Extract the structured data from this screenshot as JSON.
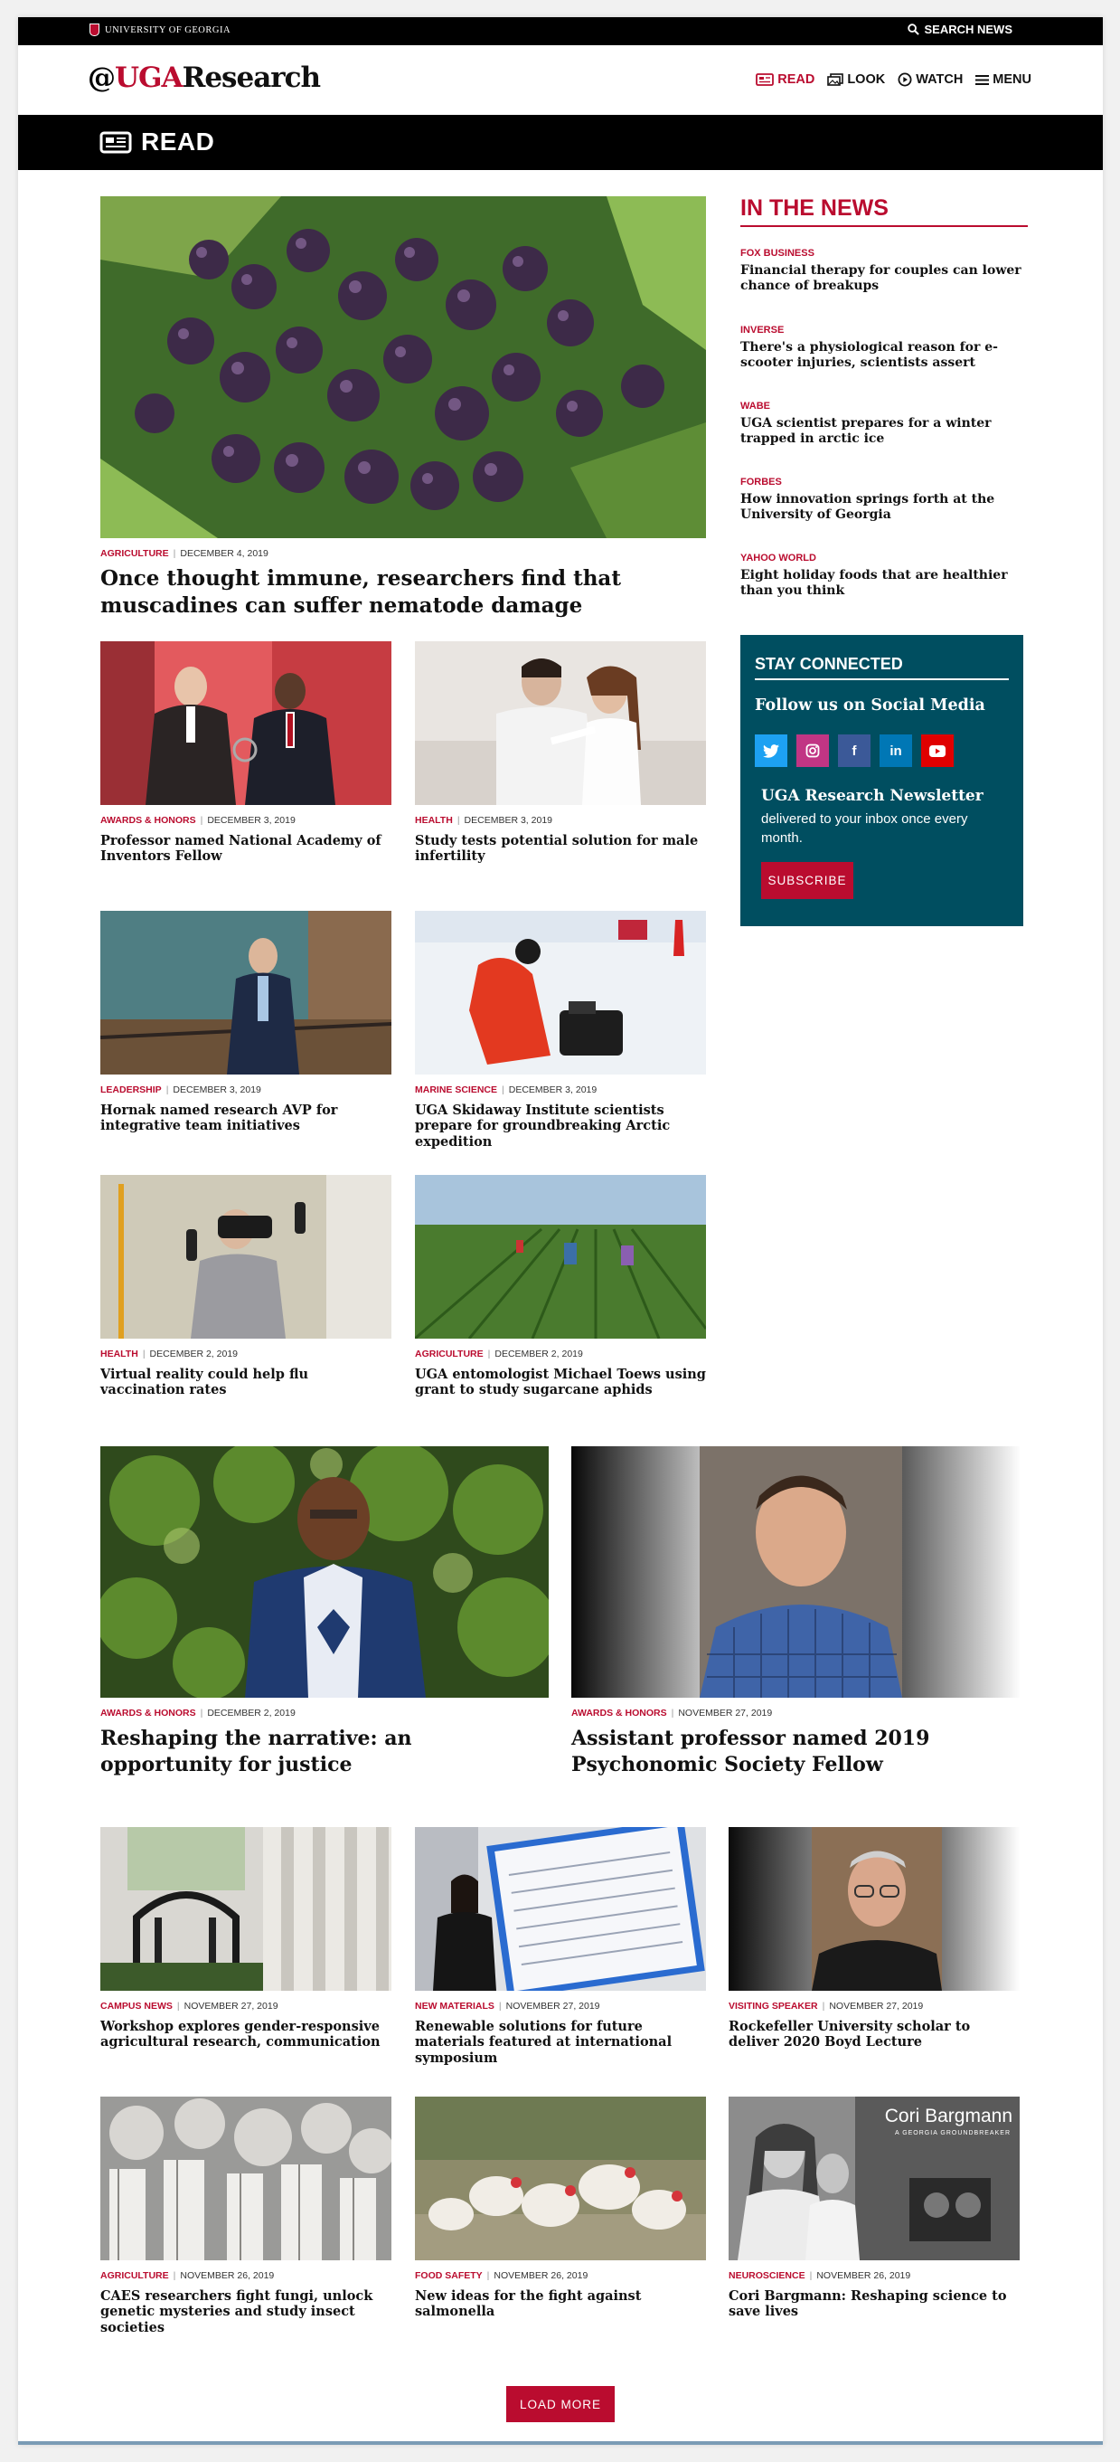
{
  "topbar": {
    "university": "UNIVERSITY OF GEORGIA",
    "search_label": "SEARCH NEWS"
  },
  "header": {
    "logo_at": "@",
    "logo_uga": "UGA",
    "logo_research": "Research",
    "nav": [
      {
        "label": "READ",
        "icon": "newspaper-icon",
        "active": true
      },
      {
        "label": "LOOK",
        "icon": "images-icon",
        "active": false
      },
      {
        "label": "WATCH",
        "icon": "play-circle-icon",
        "active": false
      },
      {
        "label": "MENU",
        "icon": "hamburger-icon",
        "active": false
      }
    ]
  },
  "section": {
    "label": "READ"
  },
  "featured": {
    "category": "AGRICULTURE",
    "date": "DECEMBER 4, 2019",
    "title": "Once thought immune, researchers find that muscadines can suffer nematode damage"
  },
  "grid_top": [
    {
      "category": "AWARDS & HONORS",
      "date": "DECEMBER 3, 2019",
      "title": "Professor named National Academy of Inventors Fellow"
    },
    {
      "category": "HEALTH",
      "date": "DECEMBER 3, 2019",
      "title": "Study tests potential solution for male infertility"
    },
    {
      "category": "LEADERSHIP",
      "date": "DECEMBER 3, 2019",
      "title": "Hornak named research AVP for integrative team initiatives"
    },
    {
      "category": "MARINE SCIENCE",
      "date": "DECEMBER 3, 2019",
      "title": "UGA Skidaway Institute scientists prepare for groundbreaking Arctic expedition"
    },
    {
      "category": "HEALTH",
      "date": "DECEMBER 2, 2019",
      "title": "Virtual reality could help flu vaccination rates"
    },
    {
      "category": "AGRICULTURE",
      "date": "DECEMBER 2, 2019",
      "title": "UGA entomologist Michael Toews using grant to study sugarcane aphids"
    }
  ],
  "in_the_news": {
    "heading": "IN THE NEWS",
    "items": [
      {
        "source": "FOX BUSINESS",
        "title": "Financial therapy for couples can lower chance of breakups"
      },
      {
        "source": "INVERSE",
        "title": "There's a physiological reason for e-scooter injuries, scientists assert"
      },
      {
        "source": "WABE",
        "title": "UGA scientist prepares for a winter trapped in arctic ice"
      },
      {
        "source": "FORBES",
        "title": "How innovation springs forth at the University of Georgia"
      },
      {
        "source": "YAHOO WORLD",
        "title": "Eight holiday foods that are healthier than you think"
      }
    ]
  },
  "stay_connected": {
    "heading": "STAY CONNECTED",
    "follow": "Follow us on Social Media",
    "socials": [
      {
        "icon": "twitter-icon",
        "glyph": "🐦",
        "color": "#1da1f2"
      },
      {
        "icon": "instagram-icon",
        "glyph": "◎",
        "color": "#c13584"
      },
      {
        "icon": "facebook-icon",
        "glyph": "f",
        "color": "#3b5998"
      },
      {
        "icon": "linkedin-icon",
        "glyph": "in",
        "color": "#0077b5"
      },
      {
        "icon": "youtube-icon",
        "glyph": "▶",
        "color": "#e00000"
      }
    ],
    "newsletter_title": "UGA Research Newsletter",
    "newsletter_sub": "delivered to your inbox once every month.",
    "subscribe_label": "SUBSCRIBE"
  },
  "wide": [
    {
      "category": "AWARDS & HONORS",
      "date": "DECEMBER 2, 2019",
      "title": "Reshaping the narrative: an opportunity for justice"
    },
    {
      "category": "AWARDS & HONORS",
      "date": "NOVEMBER 27, 2019",
      "title": "Assistant professor named 2019 Psychonomic Society Fellow"
    }
  ],
  "grid_bottom": [
    {
      "category": "CAMPUS NEWS",
      "date": "NOVEMBER 27, 2019",
      "title": "Workshop explores gender-responsive agricultural research, communication"
    },
    {
      "category": "NEW MATERIALS",
      "date": "NOVEMBER 27, 2019",
      "title": "Renewable solutions for future materials featured at international symposium"
    },
    {
      "category": "VISITING SPEAKER",
      "date": "NOVEMBER 27, 2019",
      "title": "Rockefeller University scholar to deliver 2020 Boyd Lecture"
    },
    {
      "category": "AGRICULTURE",
      "date": "NOVEMBER 26, 2019",
      "title": "CAES researchers fight fungi, unlock genetic mysteries and study insect societies"
    },
    {
      "category": "FOOD SAFETY",
      "date": "NOVEMBER 26, 2019",
      "title": "New ideas for the fight against salmonella"
    },
    {
      "category": "NEUROSCIENCE",
      "date": "NOVEMBER 26, 2019",
      "title": "Cori Bargmann: Reshaping science to save lives"
    }
  ],
  "cori_overlay": {
    "name": "Cori Bargmann",
    "tag": "A GEORGIA GROUNDBREAKER"
  },
  "load_more": "LOAD MORE"
}
